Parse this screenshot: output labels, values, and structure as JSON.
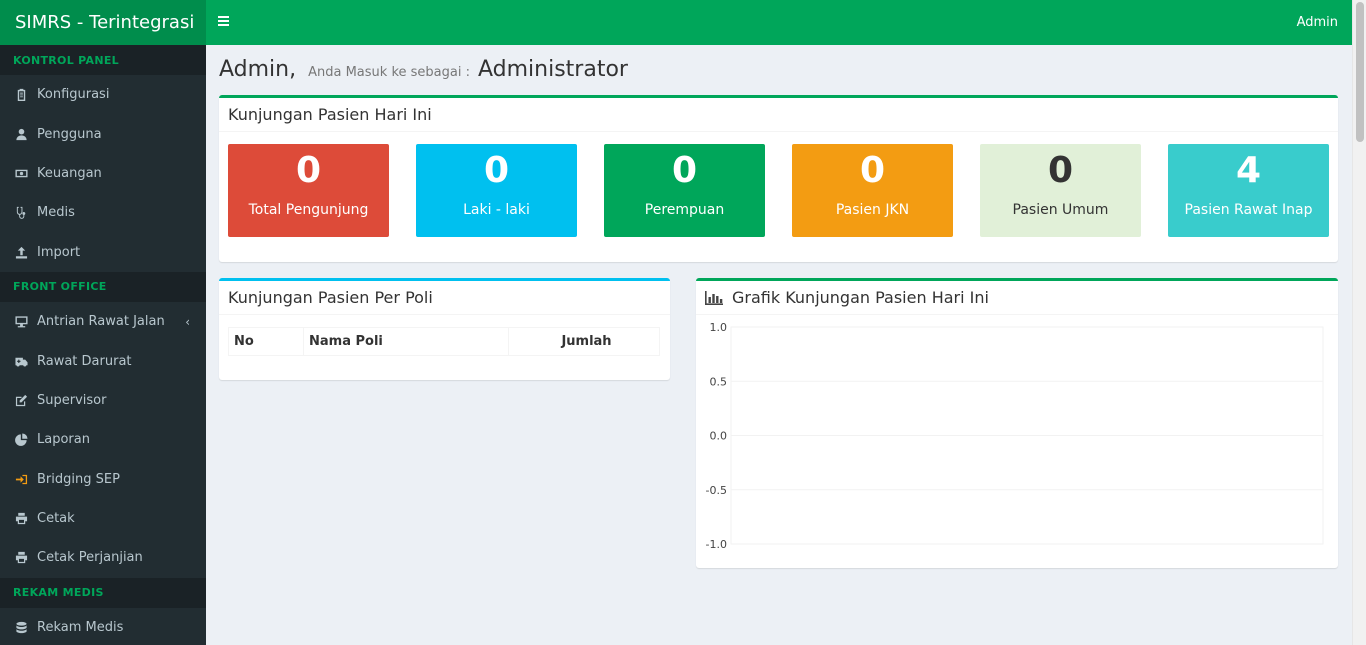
{
  "app": {
    "title": "SIMRS - Terintegrasi"
  },
  "header": {
    "user": "Admin"
  },
  "sidebar": {
    "sections": [
      {
        "title": "KONTROL PANEL",
        "items": [
          {
            "label": "Konfigurasi",
            "icon": "clipboard-icon"
          },
          {
            "label": "Pengguna",
            "icon": "user-icon"
          },
          {
            "label": "Keuangan",
            "icon": "money-icon"
          },
          {
            "label": "Medis",
            "icon": "stethoscope-icon"
          },
          {
            "label": "Import",
            "icon": "upload-icon"
          }
        ]
      },
      {
        "title": "FRONT OFFICE",
        "items": [
          {
            "label": "Antrian Rawat Jalan",
            "icon": "desktop-icon",
            "caret": "‹"
          },
          {
            "label": "Rawat Darurat",
            "icon": "ambulance-icon"
          },
          {
            "label": "Supervisor",
            "icon": "edit-icon"
          },
          {
            "label": "Laporan",
            "icon": "pie-chart-icon"
          },
          {
            "label": "Bridging SEP",
            "icon": "sign-in-icon"
          },
          {
            "label": "Cetak",
            "icon": "print-icon"
          },
          {
            "label": "Cetak Perjanjian",
            "icon": "print-icon"
          }
        ]
      },
      {
        "title": "REKAM MEDIS",
        "items": [
          {
            "label": "Rekam Medis",
            "icon": "database-icon"
          }
        ]
      }
    ]
  },
  "page": {
    "name": "Admin,",
    "subtitle": "Anda Masuk ke sebagai :",
    "role": "Administrator"
  },
  "stats_box": {
    "title": "Kunjungan Pasien Hari Ini",
    "items": [
      {
        "value": "0",
        "label": "Total Pengunjung",
        "color": "#dd4b39",
        "text_color": "#ffffff"
      },
      {
        "value": "0",
        "label": "Laki - laki",
        "color": "#00c0ef",
        "text_color": "#ffffff"
      },
      {
        "value": "0",
        "label": "Perempuan",
        "color": "#00a65a",
        "text_color": "#ffffff"
      },
      {
        "value": "0",
        "label": "Pasien JKN",
        "color": "#f39c12",
        "text_color": "#ffffff"
      },
      {
        "value": "0",
        "label": "Pasien Umum",
        "color": "#e1f0d8",
        "text_color": "#333333"
      },
      {
        "value": "4",
        "label": "Pasien Rawat Inap",
        "color": "#39cccc",
        "text_color": "#ffffff"
      }
    ]
  },
  "poli_box": {
    "title": "Kunjungan Pasien Per Poli",
    "columns": [
      "No",
      "Nama Poli",
      "Jumlah"
    ]
  },
  "chart_box": {
    "title": "Grafik Kunjungan Pasien Hari Ini",
    "icon": "bar-chart-icon"
  },
  "chart_data": {
    "type": "bar",
    "categories": [],
    "series": [],
    "title": "",
    "xlabel": "",
    "ylabel": "",
    "ylim": [
      -1.0,
      1.0
    ],
    "yticks": [
      "1.0",
      "0.5",
      "0.0",
      "-0.5",
      "-1.0"
    ],
    "grid": true
  }
}
